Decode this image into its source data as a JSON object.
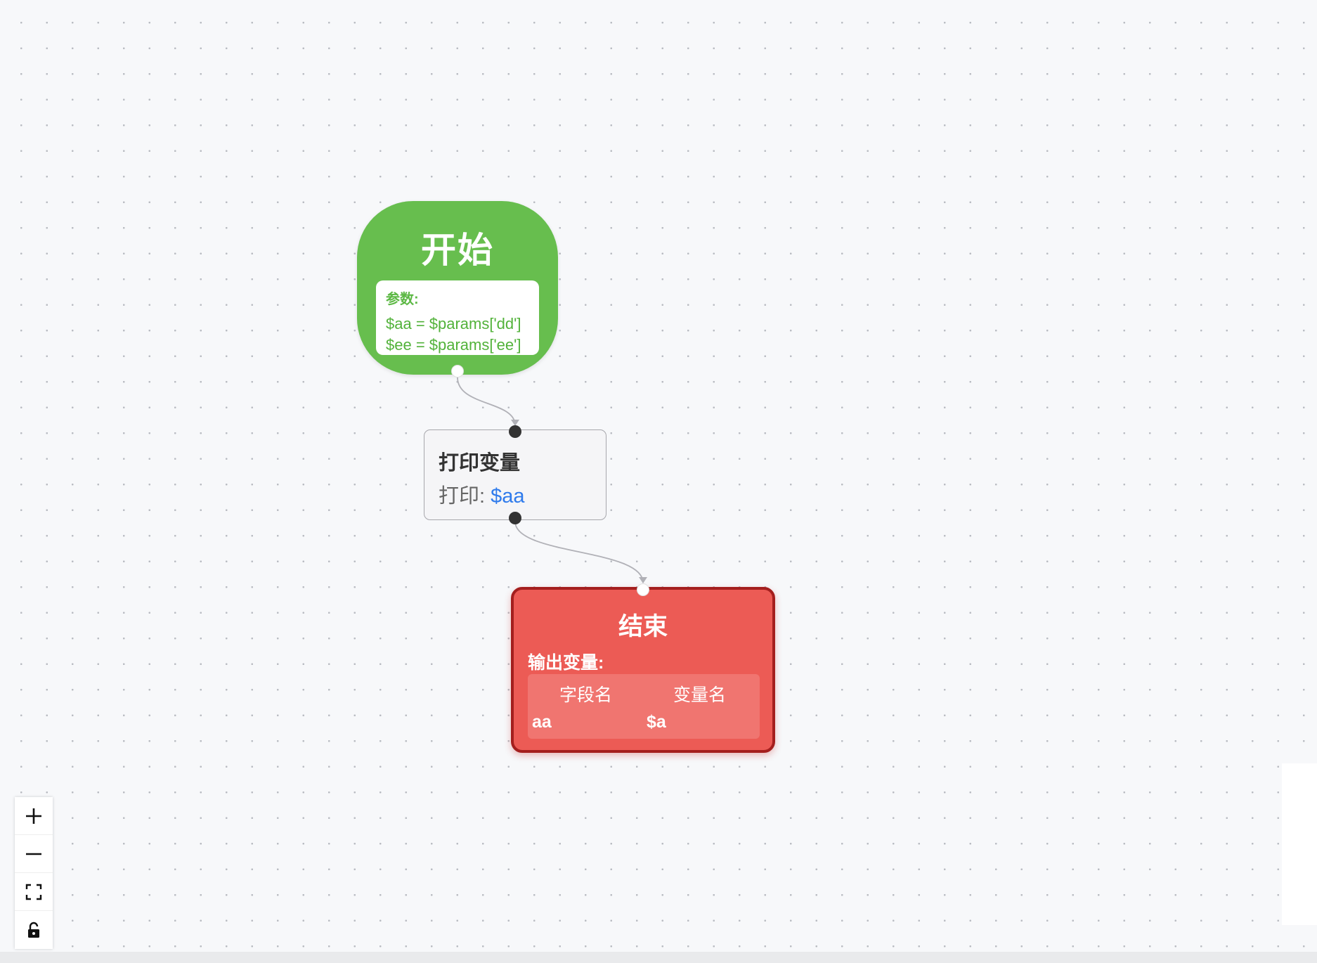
{
  "start_node": {
    "title": "开始",
    "params_label": "参数:",
    "params": [
      "$aa = $params['dd']",
      "$ee = $params['ee']"
    ],
    "color": "#67be4e"
  },
  "print_node": {
    "title": "打印变量",
    "line_prefix": "打印:",
    "line_var": "$aa",
    "var_color": "#2f7bec"
  },
  "end_node": {
    "title": "结束",
    "output_label": "输出变量:",
    "table": {
      "headers": [
        "字段名",
        "变量名"
      ],
      "rows": [
        [
          "aa",
          "$a"
        ]
      ]
    },
    "color": "#ec5b55"
  },
  "controls": [
    {
      "icon": "plus-icon",
      "action": "zoom-in"
    },
    {
      "icon": "minus-icon",
      "action": "zoom-out"
    },
    {
      "icon": "fit-view-icon",
      "action": "fit-view"
    },
    {
      "icon": "unlock-icon",
      "action": "toggle-interactivity"
    }
  ]
}
